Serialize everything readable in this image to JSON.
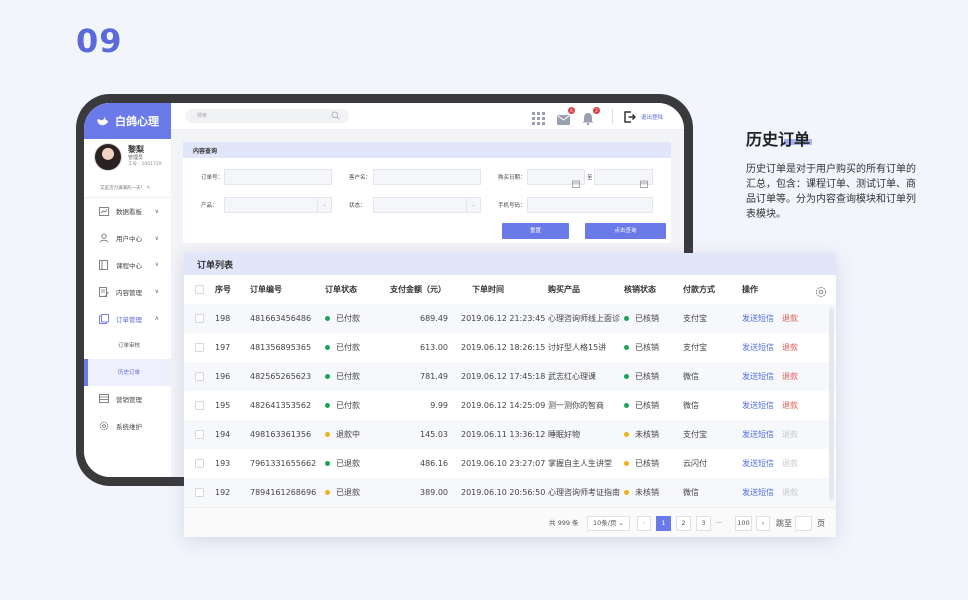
{
  "page_number": "09",
  "app": {
    "brand": "白鸽心理"
  },
  "profile": {
    "name": "黎梨",
    "role": "管理员",
    "id": "工号：100172X",
    "motto": "又是活力满满的一天！"
  },
  "menu": [
    {
      "label": "数据看板",
      "icon": "dashboard-icon",
      "chevron": "∨"
    },
    {
      "label": "用户中心",
      "icon": "user-icon",
      "chevron": "∨"
    },
    {
      "label": "课程中心",
      "icon": "book-icon",
      "chevron": "∨"
    },
    {
      "label": "内容管理",
      "icon": "doc-edit-icon",
      "chevron": "∨"
    },
    {
      "label": "订单管理",
      "icon": "orders-icon",
      "chevron": "∧"
    }
  ],
  "submenu": [
    {
      "label": "订单审核"
    },
    {
      "label": "历史订单"
    }
  ],
  "menu_bottom": [
    {
      "label": "营销管理",
      "icon": "marketing-icon"
    },
    {
      "label": "系统维护",
      "icon": "settings-icon"
    }
  ],
  "topbar": {
    "search_placeholder": "搜索",
    "mail_badge": "6",
    "bell_badge": "2",
    "logout": "退出登陆"
  },
  "query": {
    "title": "内容查询",
    "order_no": "订单号：",
    "customer": "客户名：",
    "date": "购买日期：",
    "date_to": "至",
    "product": "产品：",
    "status": "状态：",
    "phone": "手机号码：",
    "reset": "重置",
    "submit": "点击查询"
  },
  "orders": {
    "title": "订单列表",
    "columns": [
      "序号",
      "订单编号",
      "订单状态",
      "支付金额（元）",
      "下单时间",
      "购买产品",
      "核销状态",
      "付款方式",
      "操作"
    ],
    "rows": [
      {
        "no": "198",
        "order": "481663456486",
        "status": "已付款",
        "status_color": "#1aa35a",
        "amount": "689.49",
        "time": "2019.06.12 21:23:45",
        "product": "心理咨询师线上面诊",
        "verify": "已核销",
        "verify_color": "#1aa35a",
        "pay": "支付宝",
        "action": "发送短信",
        "refund": "退款",
        "refund_disabled": false
      },
      {
        "no": "197",
        "order": "481356895365",
        "status": "已付款",
        "status_color": "#1aa35a",
        "amount": "613.00",
        "time": "2019.06.12 18:26:15",
        "product": "讨好型人格15讲",
        "verify": "已核销",
        "verify_color": "#1aa35a",
        "pay": "支付宝",
        "action": "发送短信",
        "refund": "退款",
        "refund_disabled": false
      },
      {
        "no": "196",
        "order": "482565265623",
        "status": "已付款",
        "status_color": "#1aa35a",
        "amount": "781.49",
        "time": "2019.06.12 17:45:18",
        "product": "武志红心理课",
        "verify": "已核销",
        "verify_color": "#1aa35a",
        "pay": "微信",
        "action": "发送短信",
        "refund": "退款",
        "refund_disabled": false
      },
      {
        "no": "195",
        "order": "482641353562",
        "status": "已付款",
        "status_color": "#1aa35a",
        "amount": "9.99",
        "time": "2019.06.12 14:25:09",
        "product": "测一测你的智商",
        "verify": "已核销",
        "verify_color": "#1aa35a",
        "pay": "微信",
        "action": "发送短信",
        "refund": "退款",
        "refund_disabled": false
      },
      {
        "no": "194",
        "order": "498163361356",
        "status": "退款中",
        "status_color": "#f0b21b",
        "amount": "145.03",
        "time": "2019.06.11 13:36:12",
        "product": "睡眠好物",
        "verify": "未核销",
        "verify_color": "#f0b21b",
        "pay": "支付宝",
        "action": "发送短信",
        "refund": "退款",
        "refund_disabled": true
      },
      {
        "no": "193",
        "order": "7961331655662",
        "status": "已退款",
        "status_color": "#1aa35a",
        "amount": "486.16",
        "time": "2019.06.10 23:27:07",
        "product": "掌握自主人生讲堂",
        "verify": "已核销",
        "verify_color": "#f0b21b",
        "pay": "云闪付",
        "action": "发送短信",
        "refund": "退款",
        "refund_disabled": true
      },
      {
        "no": "192",
        "order": "7894161268696",
        "status": "已退款",
        "status_color": "#f0b21b",
        "amount": "389.00",
        "time": "2019.06.10 20:56:50",
        "product": "心理咨询师考证指南",
        "verify": "未核销",
        "verify_color": "#f0b21b",
        "pay": "微信",
        "action": "发送短信",
        "refund": "退款",
        "refund_disabled": true
      }
    ]
  },
  "pagination": {
    "total": "共 999 条",
    "page_size": "10条/页",
    "pages": [
      "1",
      "2",
      "3"
    ],
    "ellipsis": "···",
    "last": "100",
    "jump": "跳至",
    "page_unit": "页",
    "prev": "‹",
    "next": "›"
  },
  "side": {
    "title": "历史订单",
    "description": "历史订单是对于用户购买的所有订单的汇总，包含：课程订单、测试订单、商品订单等。分为内容查询模块和订单列表模块。"
  },
  "colors": {
    "accent": "#6a7ae8",
    "paid": "#1aa35a",
    "pending": "#f0b21b",
    "refund": "#e25a4f"
  }
}
